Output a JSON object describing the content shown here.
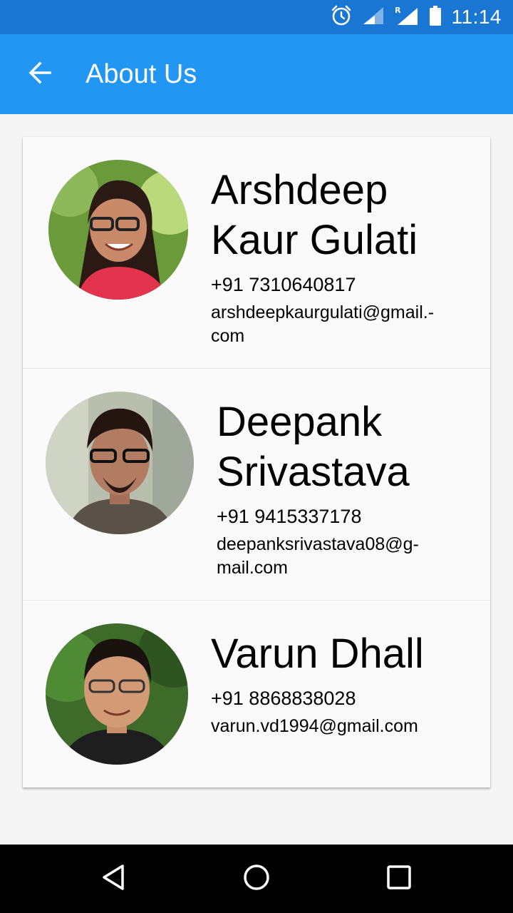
{
  "status_bar": {
    "time": "11:14",
    "icons": [
      "alarm-icon",
      "signal-icon",
      "roaming-signal-icon",
      "battery-icon"
    ]
  },
  "app_bar": {
    "back_icon": "arrow-back-icon",
    "title": "About Us"
  },
  "people": [
    {
      "name": "Arshdeep Kaur Gulati",
      "phone": "+91 7310640817",
      "email": "arshdeepkaurgulati@gmail.-\ncom"
    },
    {
      "name": "Deepank Srivastava",
      "phone": "+91 9415337178",
      "email": "deepanksrivastava08@g-\nmail.com"
    },
    {
      "name": "Varun Dhall",
      "phone": "+91 8868838028",
      "email": "varun.vd1994@gmail.com"
    }
  ],
  "nav_bar": {
    "icons": [
      "back-triangle-icon",
      "home-circle-icon",
      "recents-square-icon"
    ]
  },
  "colors": {
    "status_bar": "#1976d2",
    "app_bar": "#2196f3",
    "card": "#fafafa"
  }
}
